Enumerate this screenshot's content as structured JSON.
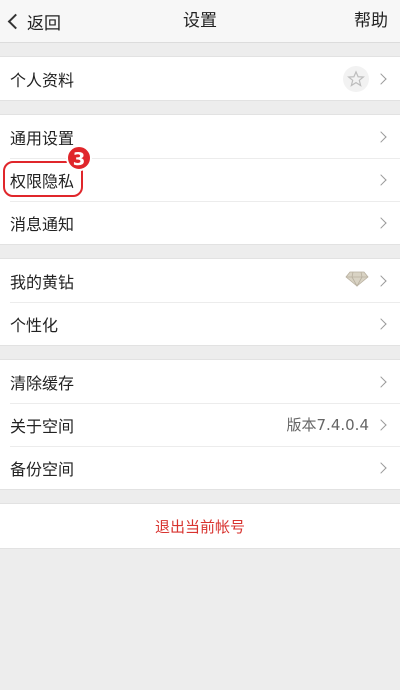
{
  "navbar": {
    "back_label": "返回",
    "title": "设置",
    "help_label": "帮助"
  },
  "groups": [
    {
      "items": [
        {
          "label": "个人资料",
          "icon": "star-icon"
        }
      ]
    },
    {
      "items": [
        {
          "label": "通用设置"
        },
        {
          "label": "权限隐私"
        },
        {
          "label": "消息通知"
        }
      ]
    },
    {
      "items": [
        {
          "label": "我的黄钻",
          "icon": "diamond-icon"
        },
        {
          "label": "个性化"
        }
      ]
    },
    {
      "items": [
        {
          "label": "清除缓存"
        },
        {
          "label": "关于空间",
          "value": "版本7.4.0.4"
        },
        {
          "label": "备份空间"
        }
      ]
    }
  ],
  "annotation": {
    "step_number": "3",
    "color": "#e0262b"
  },
  "logout": {
    "label": "退出当前帐号",
    "color": "#d8332f"
  }
}
